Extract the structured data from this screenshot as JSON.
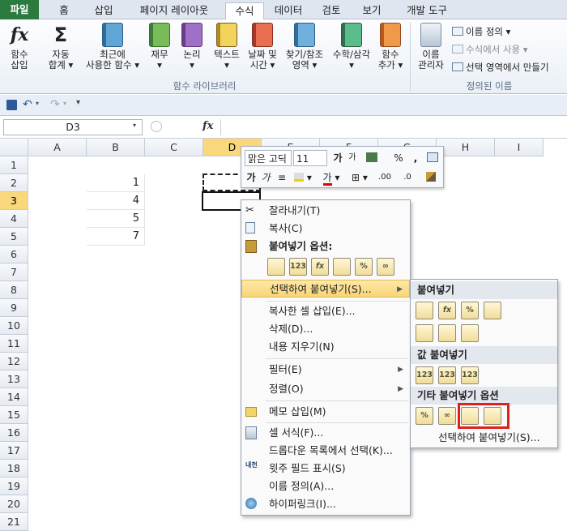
{
  "tabs": [
    "파일",
    "홈",
    "삽입",
    "페이지 레이아웃",
    "수식",
    "데이터",
    "검토",
    "보기",
    "개발 도구"
  ],
  "ribbon": {
    "insert_function": [
      "함수",
      "삽입"
    ],
    "autosum": [
      "자동",
      "합계 ▾"
    ],
    "recent": [
      "최근에",
      "사용한 함수 ▾"
    ],
    "financial": [
      "재무",
      "▾"
    ],
    "logical": [
      "논리",
      "▾"
    ],
    "text": [
      "텍스트",
      "▾"
    ],
    "datetime": [
      "날짜 및",
      "시간 ▾"
    ],
    "lookup": [
      "찾기/참조",
      "영역 ▾"
    ],
    "math": [
      "수학/삼각",
      "▾"
    ],
    "more": [
      "함수",
      "추가 ▾"
    ],
    "group_library": "함수 라이브러리",
    "name_manager": [
      "이름",
      "관리자"
    ],
    "define_name": "이름 정의 ▾",
    "use_in_formula": "수식에서 사용 ▾",
    "create_from_sel": "선택 영역에서 만들기",
    "group_names": "정의된 이름"
  },
  "formula_bar": {
    "name_box": "D3",
    "fx": "fx"
  },
  "columns": [
    "A",
    "B",
    "C",
    "D",
    "E",
    "F",
    "G",
    "H",
    "I"
  ],
  "rows": [
    "1",
    "2",
    "3",
    "4",
    "5",
    "6",
    "7",
    "8",
    "9",
    "10",
    "11",
    "12",
    "13",
    "14",
    "15",
    "16",
    "17",
    "18",
    "19",
    "20",
    "21"
  ],
  "cells_b": [
    "",
    "1",
    "4",
    "5",
    "7"
  ],
  "mini_toolbar": {
    "font": "맑은 고딕",
    "size": "11",
    "grow": "가",
    "shrink": "가",
    "percent": "%",
    "comma": ",",
    "bold": "가",
    "italic": "가",
    "underline_font_color": "가",
    "dec_inc": ".00",
    "dec_dec": ".0"
  },
  "context_menu": {
    "cut": "잘라내기(T)",
    "copy": "복사(C)",
    "paste_options": "붙여넣기 옵션:",
    "paste_special": "선택하여 붙여넣기(S)...",
    "insert_copied": "복사한 셀 삽입(E)...",
    "delete": "삭제(D)...",
    "clear": "내용 지우기(N)",
    "filter": "필터(E)",
    "sort": "정렬(O)",
    "insert_memo": "메모 삽입(M)",
    "format_cells": "셀 서식(F)...",
    "pick_dropdown": "드롭다운 목록에서 선택(K)...",
    "phonetic": "윗주 필드 표시(S)",
    "define_name": "이름 정의(A)...",
    "hyperlink": "하이퍼링크(I)...",
    "phonetic_icon_text": "내천"
  },
  "submenu": {
    "paste": "붙여넣기",
    "paste_values": "값 붙여넣기",
    "other_paste": "기타 붙여넣기 옵션",
    "paste_special": "선택하여 붙여넣기(S)..."
  },
  "paste_icons_label": {
    "values": "123",
    "formula": "fx",
    "percent": "%"
  }
}
